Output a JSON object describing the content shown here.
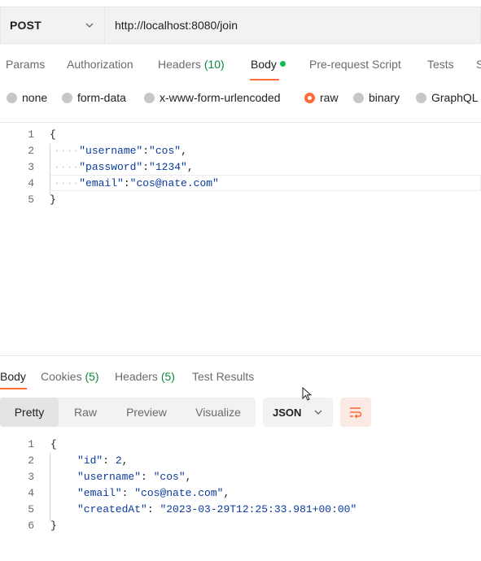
{
  "request": {
    "method": "POST",
    "url": "http://localhost:8080/join"
  },
  "request_tabs": [
    {
      "label": "Params"
    },
    {
      "label": "Authorization"
    },
    {
      "label": "Headers",
      "count": "(10)"
    },
    {
      "label": "Body",
      "active": true
    },
    {
      "label": "Pre-request Script"
    },
    {
      "label": "Tests"
    },
    {
      "label": "S"
    }
  ],
  "body_types": [
    {
      "label": "none"
    },
    {
      "label": "form-data"
    },
    {
      "label": "x-www-form-urlencoded"
    },
    {
      "label": "raw",
      "selected": true
    },
    {
      "label": "binary"
    },
    {
      "label": "GraphQL"
    }
  ],
  "request_body": {
    "line_numbers": [
      "1",
      "2",
      "3",
      "4",
      "5"
    ],
    "open_brace": "{",
    "close_brace": "}",
    "fields": [
      {
        "key": "\"username\"",
        "value": "\"cos\"",
        "sep": ":",
        "trail": ","
      },
      {
        "key": "\"password\"",
        "value": "\"1234\"",
        "sep": ":",
        "trail": ","
      },
      {
        "key": "\"email\"",
        "value": "\"cos@nate.com\"",
        "sep": ":",
        "trail": ""
      }
    ]
  },
  "response_tabs": [
    {
      "label": "Body",
      "active": true
    },
    {
      "label": "Cookies",
      "count": "(5)"
    },
    {
      "label": "Headers",
      "count": "(5)"
    },
    {
      "label": "Test Results"
    }
  ],
  "response_views": [
    {
      "label": "Pretty",
      "active": true
    },
    {
      "label": "Raw"
    },
    {
      "label": "Preview"
    },
    {
      "label": "Visualize"
    }
  ],
  "response_format": "JSON",
  "response_body": {
    "line_numbers": [
      "1",
      "2",
      "3",
      "4",
      "5",
      "6"
    ],
    "open_brace": "{",
    "close_brace": "}",
    "fields": [
      {
        "key": "\"id\"",
        "value": "2",
        "sep": ": ",
        "trail": ","
      },
      {
        "key": "\"username\"",
        "value": "\"cos\"",
        "sep": ": ",
        "trail": ","
      },
      {
        "key": "\"email\"",
        "value": "\"cos@nate.com\"",
        "sep": ": ",
        "trail": ","
      },
      {
        "key": "\"createdAt\"",
        "value": "\"2023-03-29T12:25:33.981+00:00\"",
        "sep": ": ",
        "trail": ""
      }
    ]
  },
  "colors": {
    "accent": "#ff6c37",
    "json_string": "#0b3a9e",
    "count_green": "#0a8a3e"
  }
}
